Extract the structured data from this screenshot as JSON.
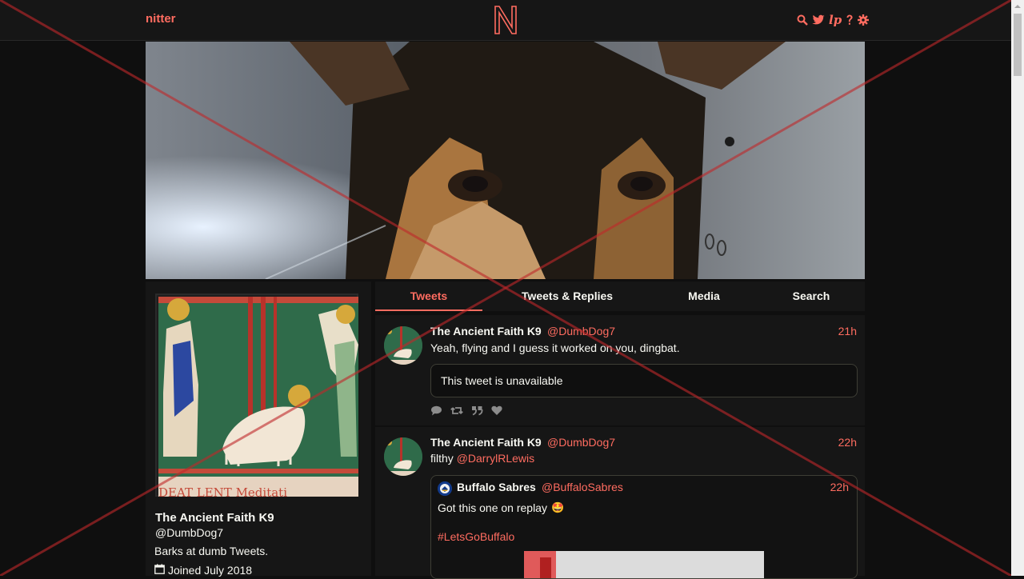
{
  "nav": {
    "logo_text": "nitter",
    "center_logo": "N",
    "icons": [
      "search-icon",
      "twitter-bird-icon",
      "lp-icon",
      "help-icon",
      "gear-icon"
    ],
    "lp_text": "lp"
  },
  "profile": {
    "fullname": "The Ancient Faith K9",
    "username": "@DumbDog7",
    "bio": "Barks at dumb Tweets.",
    "joined": "Joined July 2018",
    "avatar_caption": "DEAT LENT Meditati"
  },
  "tabs": [
    {
      "label": "Tweets",
      "active": true
    },
    {
      "label": "Tweets & Replies",
      "active": false
    },
    {
      "label": "Media",
      "active": false
    },
    {
      "label": "Search",
      "active": false
    }
  ],
  "tweets": [
    {
      "fullname": "The Ancient Faith K9",
      "username": "@DumbDog7",
      "time": "21h",
      "text": "Yeah, flying and I guess it worked on you, dingbat.",
      "unavailable": "This tweet is unavailable"
    },
    {
      "fullname": "The Ancient Faith K9",
      "username": "@DumbDog7",
      "time": "22h",
      "text_prefix": "filthy",
      "mention": "@DarrylRLewis",
      "quote": {
        "fullname": "Buffalo Sabres",
        "username": "@BuffaloSabres",
        "time": "22h",
        "text": "Got this one on replay",
        "emoji": "🤩",
        "hashtag": "#LetsGoBuffalo"
      }
    }
  ],
  "colors": {
    "accent": "#ff6c60",
    "background": "#0f0f0f",
    "panel": "#161616",
    "text": "#f8f8f2"
  }
}
